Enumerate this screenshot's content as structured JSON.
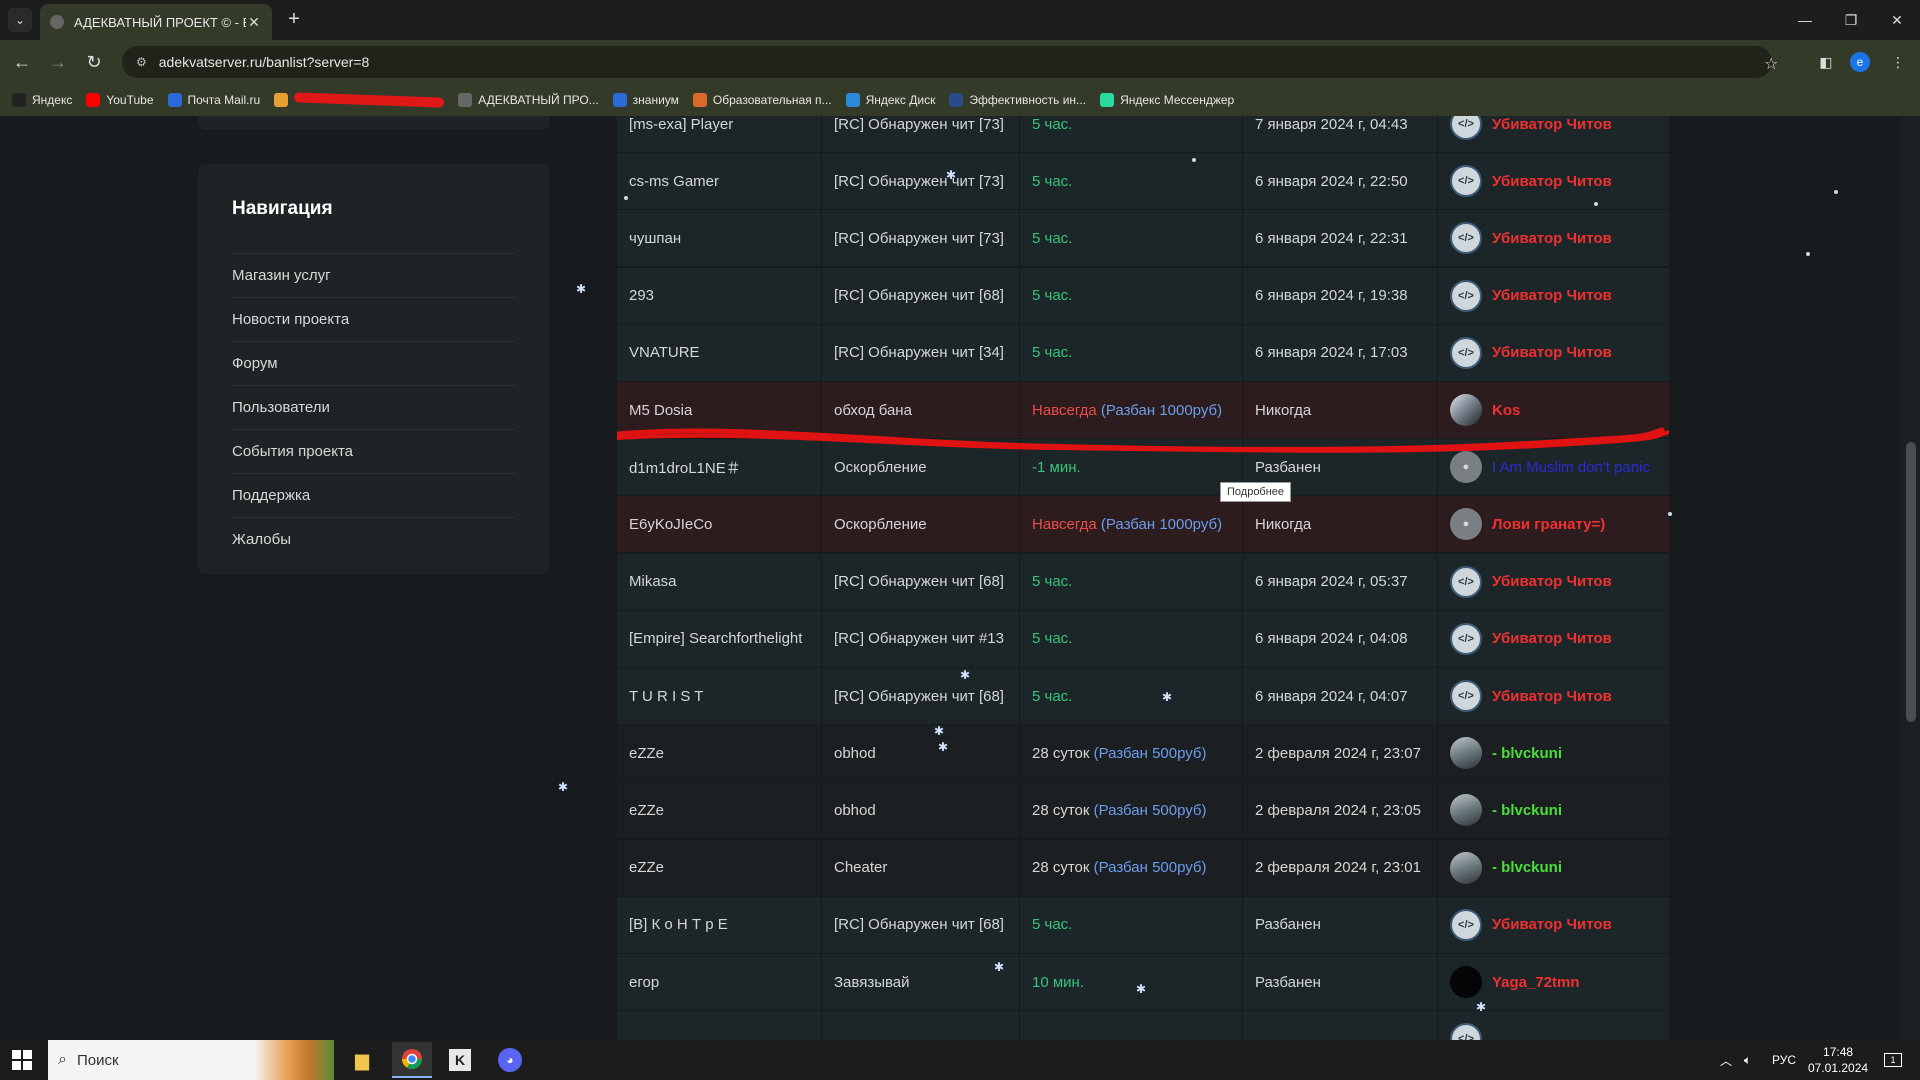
{
  "browser": {
    "tab_title": "АДЕКВАТНЫЙ ПРОЕКТ © - Бан",
    "url": "adekvatserver.ru/banlist?server=8",
    "profile_initial": "e",
    "bookmarks": [
      {
        "label": "Яндекс",
        "icon": "yandex-icon",
        "color": "#222222"
      },
      {
        "label": "YouTube",
        "icon": "youtube-icon",
        "color": "#ff0000"
      },
      {
        "label": "Почта Mail.ru",
        "icon": "mail-icon",
        "color": "#2a6ad8"
      },
      {
        "label": "",
        "icon": "redacted-bookmark-icon",
        "color": "#e8a030"
      },
      {
        "label": "АДЕКВАТНЫЙ ПРО...",
        "icon": "adekvat-icon",
        "color": "#666666"
      },
      {
        "label": "знаниум",
        "icon": "znanium-icon",
        "color": "#2a6ad8"
      },
      {
        "label": "Образовательная п...",
        "icon": "edu-icon",
        "color": "#d86a2a"
      },
      {
        "label": "Яндекс Диск",
        "icon": "yandex-disk-icon",
        "color": "#2a8ad8"
      },
      {
        "label": "Эффективность ин...",
        "icon": "efficiency-icon",
        "color": "#2a4a88"
      },
      {
        "label": "Яндекс Мессенджер",
        "icon": "messenger-icon",
        "color": "#2ad8a0"
      }
    ]
  },
  "nav": {
    "title": "Навигация",
    "items": [
      "Магазин услуг",
      "Новости проекта",
      "Форум",
      "Пользователи",
      "События проекта",
      "Поддержка",
      "Жалобы"
    ]
  },
  "bans": [
    {
      "player": "[ms-exa] Player",
      "reason": "[RC] Обнаружен чит [73]",
      "term": "5 час.",
      "term_style": "green",
      "unban": "",
      "expires": "7 января 2024 г, 04:43",
      "admin": "Убиватор Читов",
      "admin_style": "admin-red",
      "avatar": "av-code",
      "bg": "bg-dark"
    },
    {
      "player": "cs-ms Gamer",
      "reason": "[RC] Обнаружен чит [73]",
      "term": "5 час.",
      "term_style": "green",
      "unban": "",
      "expires": "6 января 2024 г, 22:50",
      "admin": "Убиватор Читов",
      "admin_style": "admin-red",
      "avatar": "av-code",
      "bg": "bg-dark"
    },
    {
      "player": "чушпан",
      "reason": "[RC] Обнаружен чит [73]",
      "term": "5 час.",
      "term_style": "green",
      "unban": "",
      "expires": "6 января 2024 г, 22:31",
      "admin": "Убиватор Читов",
      "admin_style": "admin-red",
      "avatar": "av-code",
      "bg": "bg-dark"
    },
    {
      "player": "293",
      "reason": "[RC] Обнаружен чит [68]",
      "term": "5 час.",
      "term_style": "green",
      "unban": "",
      "expires": "6 января 2024 г, 19:38",
      "admin": "Убиватор Читов",
      "admin_style": "admin-red",
      "avatar": "av-code",
      "bg": "bg-dark"
    },
    {
      "player": "VNATURE",
      "reason": "[RC] Обнаружен чит [34]",
      "term": "5 час.",
      "term_style": "green",
      "unban": "",
      "expires": "6 января 2024 г, 17:03",
      "admin": "Убиватор Читов",
      "admin_style": "admin-red",
      "avatar": "av-code",
      "bg": "bg-dark"
    },
    {
      "player": "M5 Dosia",
      "reason": "обход бана",
      "term": "Навсегда",
      "term_style": "red",
      "unban": "(Разбан 1000руб)",
      "expires": "Никогда",
      "admin": "Kos",
      "admin_style": "admin-red",
      "avatar": "av-kos",
      "bg": "bg-red"
    },
    {
      "player": "d1m1droL1NE＃",
      "reason": "Оскорбление",
      "term": "-1 мин.",
      "term_style": "green",
      "unban": "",
      "expires": "Разбанен",
      "admin": "I Am Muslim don't panic",
      "admin_style": "admin-blue",
      "avatar": "av-user",
      "bg": "bg-dark"
    },
    {
      "player": "E6yKoJIeCo",
      "reason": "Оскорбление",
      "term": "Навсегда",
      "term_style": "red",
      "unban": "(Разбан 1000руб)",
      "expires": "Никогда",
      "admin": "Лови гранату=)",
      "admin_style": "admin-red",
      "avatar": "av-user",
      "bg": "bg-red"
    },
    {
      "player": "Mikasa",
      "reason": "[RC] Обнаружен чит [68]",
      "term": "5 час.",
      "term_style": "green",
      "unban": "",
      "expires": "6 января 2024 г, 05:37",
      "admin": "Убиватор Читов",
      "admin_style": "admin-red",
      "avatar": "av-code",
      "bg": "bg-dark"
    },
    {
      "player": "[Empire] Searchforthelight",
      "reason": "[RC] Обнаружен чит #13",
      "term": "5 час.",
      "term_style": "green",
      "unban": "",
      "expires": "6 января 2024 г, 04:08",
      "admin": "Убиватор Читов",
      "admin_style": "admin-red",
      "avatar": "av-code",
      "bg": "bg-dark"
    },
    {
      "player": "T U R I S T",
      "reason": "[RC] Обнаружен чит [68]",
      "term": "5 час.",
      "term_style": "green",
      "unban": "",
      "expires": "6 января 2024 г, 04:07",
      "admin": "Убиватор Читов",
      "admin_style": "admin-red",
      "avatar": "av-code",
      "bg": "bg-dark"
    },
    {
      "player": "eZZe",
      "reason": "obhod",
      "term": "28 суток",
      "term_style": "plain",
      "unban": "(Разбан 500руб)",
      "expires": "2 февраля 2024 г, 23:07",
      "admin": "- blvckuni",
      "admin_style": "admin-green",
      "avatar": "av-photo",
      "bg": "bg-plain"
    },
    {
      "player": "eZZe",
      "reason": "obhod",
      "term": "28 суток",
      "term_style": "plain",
      "unban": "(Разбан 500руб)",
      "expires": "2 февраля 2024 г, 23:05",
      "admin": "- blvckuni",
      "admin_style": "admin-green",
      "avatar": "av-photo",
      "bg": "bg-plain"
    },
    {
      "player": "eZZe",
      "reason": "Cheater",
      "term": "28 суток",
      "term_style": "plain",
      "unban": "(Разбан 500руб)",
      "expires": "2 февраля 2024 г, 23:01",
      "admin": "- blvckuni",
      "admin_style": "admin-green",
      "avatar": "av-photo",
      "bg": "bg-plain"
    },
    {
      "player": "[B] К о Н Т р Е",
      "reason": "[RC] Обнаружен чит [68]",
      "term": "5 час.",
      "term_style": "green",
      "unban": "",
      "expires": "Разбанен",
      "admin": "Убиватор Читов",
      "admin_style": "admin-red",
      "avatar": "av-code",
      "bg": "bg-dark"
    },
    {
      "player": "егор",
      "reason": "Завязывай",
      "term": "10 мин.",
      "term_style": "green",
      "unban": "",
      "expires": "Разбанен",
      "admin": "Yaga_72tmn",
      "admin_style": "admin-red",
      "avatar": "av-black",
      "bg": "bg-dark"
    },
    {
      "player": "",
      "reason": "",
      "term": "",
      "term_style": "plain",
      "unban": "",
      "expires": "",
      "admin": "",
      "admin_style": "admin-red",
      "avatar": "av-code",
      "bg": "bg-dark"
    }
  ],
  "tooltip": "Подробнее",
  "taskbar": {
    "search_placeholder": "Поиск",
    "lang": "РУС",
    "time": "17:48",
    "date": "07.01.2024",
    "notif_count": "1"
  },
  "colors": {
    "accent_green": "#37c37c",
    "accent_red": "#ee4b4b",
    "link_blue": "#6c9ceb"
  }
}
